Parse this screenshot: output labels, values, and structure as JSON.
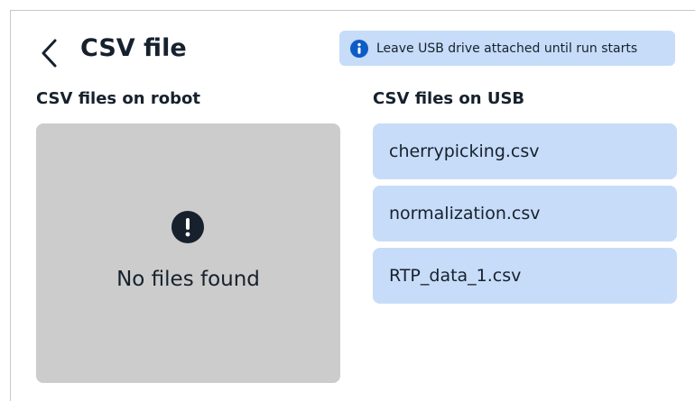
{
  "header": {
    "title": "CSV file",
    "back_icon": "chevron-left-icon"
  },
  "banner": {
    "icon": "info-icon",
    "text": "Leave USB drive attached until run starts",
    "color": "#c7dcf8",
    "icon_color": "#0d5cc6"
  },
  "robot_files": {
    "heading": "CSV files on robot",
    "empty_icon": "alert-circle-icon",
    "empty_message": "No files found",
    "panel_color": "#cccccc"
  },
  "usb_files": {
    "heading": "CSV files on USB",
    "item_color": "#c7dcf8",
    "items": [
      {
        "label": "cherrypicking.csv"
      },
      {
        "label": "normalization.csv"
      },
      {
        "label": "RTP_data_1.csv"
      }
    ]
  }
}
